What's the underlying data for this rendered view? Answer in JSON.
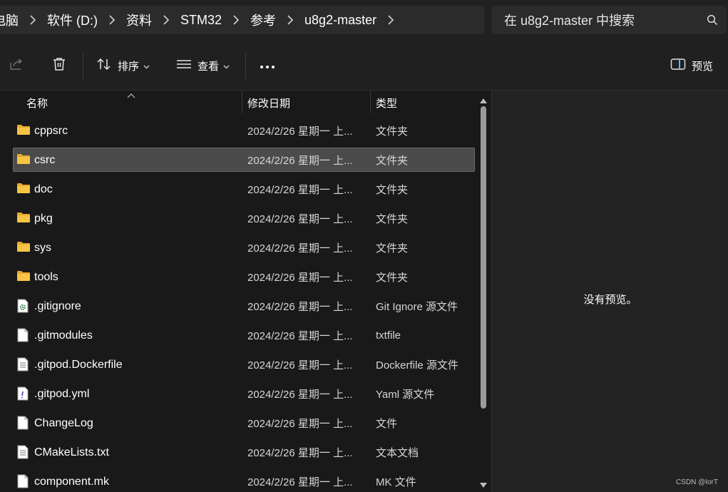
{
  "breadcrumb": {
    "items": [
      "电脑",
      "软件 (D:)",
      "资料",
      "STM32",
      "参考",
      "u8g2-master"
    ]
  },
  "search": {
    "placeholder": "在 u8g2-master 中搜索"
  },
  "toolbar": {
    "sort_label": "排序",
    "view_label": "查看",
    "more_label": "···",
    "preview_label": "预览"
  },
  "columns": {
    "name": "名称",
    "date": "修改日期",
    "type": "类型"
  },
  "files": [
    {
      "name": "cppsrc",
      "date": "2024/2/26 星期一 上...",
      "type": "文件夹",
      "icon": "folder-icon",
      "selected": false
    },
    {
      "name": "csrc",
      "date": "2024/2/26 星期一 上...",
      "type": "文件夹",
      "icon": "folder-icon",
      "selected": true
    },
    {
      "name": "doc",
      "date": "2024/2/26 星期一 上...",
      "type": "文件夹",
      "icon": "folder-icon",
      "selected": false
    },
    {
      "name": "pkg",
      "date": "2024/2/26 星期一 上...",
      "type": "文件夹",
      "icon": "folder-icon",
      "selected": false
    },
    {
      "name": "sys",
      "date": "2024/2/26 星期一 上...",
      "type": "文件夹",
      "icon": "folder-icon",
      "selected": false
    },
    {
      "name": "tools",
      "date": "2024/2/26 星期一 上...",
      "type": "文件夹",
      "icon": "folder-icon",
      "selected": false
    },
    {
      "name": ".gitignore",
      "date": "2024/2/26 星期一 上...",
      "type": "Git Ignore 源文件",
      "icon": "gear-file-icon",
      "selected": false
    },
    {
      "name": ".gitmodules",
      "date": "2024/2/26 星期一 上...",
      "type": "txtfile",
      "icon": "file-icon",
      "selected": false
    },
    {
      "name": ".gitpod.Dockerfile",
      "date": "2024/2/26 星期一 上...",
      "type": "Dockerfile 源文件",
      "icon": "text-file-icon",
      "selected": false
    },
    {
      "name": ".gitpod.yml",
      "date": "2024/2/26 星期一 上...",
      "type": "Yaml 源文件",
      "icon": "exclamation-file-icon",
      "selected": false
    },
    {
      "name": "ChangeLog",
      "date": "2024/2/26 星期一 上...",
      "type": "文件",
      "icon": "file-icon",
      "selected": false
    },
    {
      "name": "CMakeLists.txt",
      "date": "2024/2/26 星期一 上...",
      "type": "文本文档",
      "icon": "text-file-icon",
      "selected": false
    },
    {
      "name": "component.mk",
      "date": "2024/2/26 星期一 上...",
      "type": "MK 文件",
      "icon": "file-icon",
      "selected": false
    }
  ],
  "preview": {
    "message": "没有预览。"
  },
  "watermark": "CSDN @IorT",
  "colors": {
    "folder": "#f6c344",
    "selected_row": "#4b4b4b",
    "background": "#191919"
  }
}
